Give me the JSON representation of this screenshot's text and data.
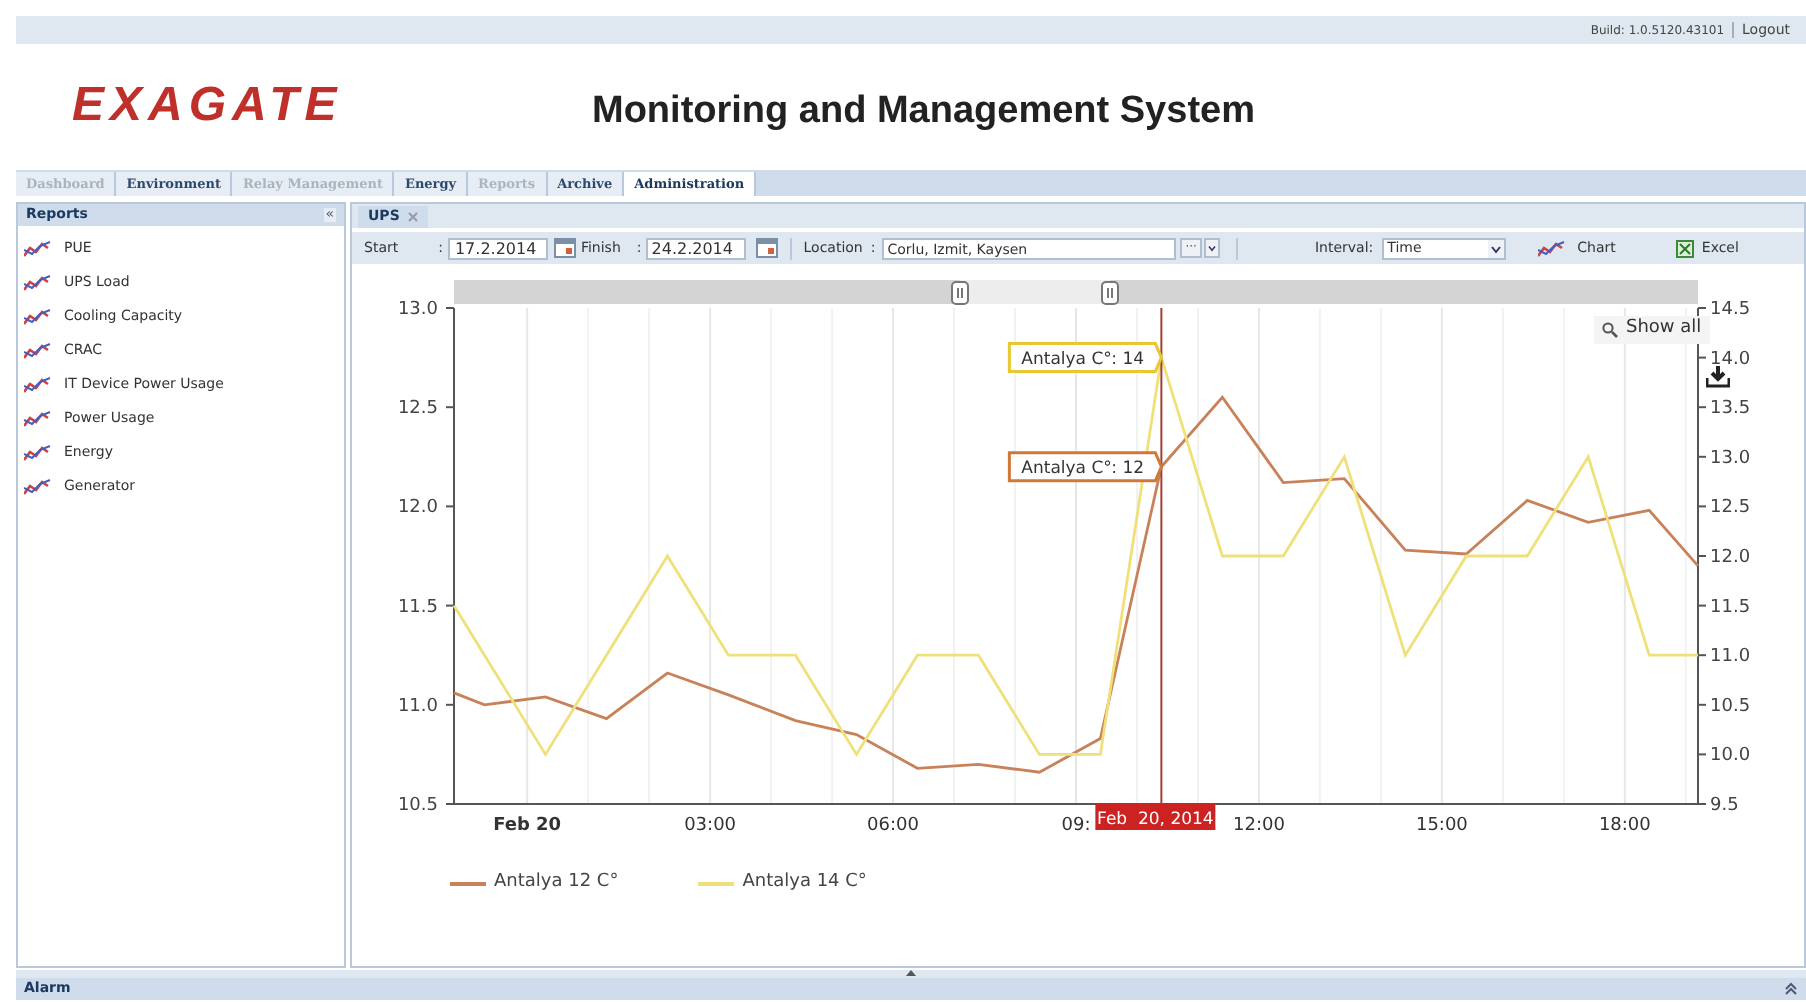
{
  "top_bar": {
    "build": "Build: 1.0.5120.43101",
    "logout": "Logout"
  },
  "header": {
    "logo": "EXAGATE",
    "title": "Monitoring and Management System"
  },
  "nav_tabs": [
    {
      "label": "Dashboard",
      "selected": false,
      "disabled": true
    },
    {
      "label": "Environment",
      "selected": false,
      "disabled": false
    },
    {
      "label": "Relay Management",
      "selected": false,
      "disabled": true
    },
    {
      "label": "Energy",
      "selected": false,
      "disabled": false
    },
    {
      "label": "Reports",
      "selected": false,
      "disabled": true
    },
    {
      "label": "Archive",
      "selected": false,
      "disabled": false
    },
    {
      "label": "Administration",
      "selected": true,
      "disabled": false
    }
  ],
  "sidebar": {
    "title": "Reports",
    "collapse": "«",
    "items": [
      {
        "label": "PUE"
      },
      {
        "label": "UPS Load"
      },
      {
        "label": "Cooling Capacity"
      },
      {
        "label": "CRAC"
      },
      {
        "label": "IT Device Power Usage"
      },
      {
        "label": "Power Usage"
      },
      {
        "label": "Energy"
      },
      {
        "label": "Generator"
      }
    ]
  },
  "content_tabs": [
    {
      "label": "UPS",
      "selected": true
    }
  ],
  "toolbar": {
    "start_label": "Start",
    "start_sep": ":",
    "start": "17.2.2014",
    "finish_label": "Finish",
    "finish_sep": ":",
    "finish": "24.2.2014",
    "location_label": "Location",
    "location_sep": ":",
    "location": "Corlu, Izmit, Kaysen",
    "ellipsis": "···",
    "interval_label": "Interval:",
    "interval": "Time",
    "chart": "Chart",
    "excel": "Excel"
  },
  "chart": {
    "show_all": "Show all",
    "chart_data": {
      "type": "line",
      "x": [
        -1.2,
        -0.7,
        0.3,
        1.3,
        2.3,
        3.3,
        4.4,
        5.4,
        6.4,
        7.4,
        8.4,
        9.4,
        10.4,
        11.4,
        12.4,
        13.4,
        14.4,
        15.4,
        16.4,
        17.4,
        18.4,
        19.2
      ],
      "series": [
        {
          "name": "Antalya 12 C°",
          "color": "#c8825a",
          "values": [
            11.06,
            11.0,
            11.04,
            10.93,
            11.16,
            11.05,
            10.92,
            10.85,
            10.68,
            10.7,
            10.66,
            10.83,
            12.2,
            12.55,
            12.12,
            12.14,
            11.78,
            11.76,
            12.03,
            11.92,
            11.98,
            11.7
          ]
        },
        {
          "name": "Antalya 14 C°",
          "color": "#f0e07a",
          "axis": "y2",
          "values": [
            11.5,
            11.0,
            10.0,
            11.0,
            12.0,
            11.0,
            11.0,
            10.0,
            11.0,
            11.0,
            10.0,
            10.0,
            14.0,
            12.0,
            12.0,
            13.0,
            11.0,
            12.0,
            12.0,
            13.0,
            11.0,
            11.0
          ]
        }
      ],
      "xlim": [
        -1.2,
        19.2
      ],
      "ylim": [
        10.5,
        13.0
      ],
      "y2lim": [
        9.5,
        14.5
      ],
      "xticks": [
        {
          "value": 0,
          "label": "Feb 20"
        },
        {
          "value": 3,
          "label": "03:00"
        },
        {
          "value": 6,
          "label": "06:00"
        },
        {
          "value": 9,
          "label": "09:"
        },
        {
          "value": 12,
          "label": "12:00"
        },
        {
          "value": 15,
          "label": "15:00"
        },
        {
          "value": 18,
          "label": "18:00"
        }
      ],
      "yticks": [
        {
          "value": 10.5,
          "label": "10.5"
        },
        {
          "value": 11,
          "label": "11.0"
        },
        {
          "value": 11.5,
          "label": "11.5"
        },
        {
          "value": 12,
          "label": "12.0"
        },
        {
          "value": 12.5,
          "label": "12.5"
        },
        {
          "value": 13,
          "label": "13.0"
        }
      ],
      "y2ticks": [
        {
          "value": 9.5,
          "label": "9.5"
        },
        {
          "value": 10,
          "label": "10.0"
        },
        {
          "value": 10.5,
          "label": "10.5"
        },
        {
          "value": 11,
          "label": "11.0"
        },
        {
          "value": 11.5,
          "label": "11.5"
        },
        {
          "value": 12,
          "label": "12.0"
        },
        {
          "value": 12.5,
          "label": "12.5"
        },
        {
          "value": 13,
          "label": "13.0"
        },
        {
          "value": 13.5,
          "label": "13.5"
        },
        {
          "value": 14,
          "label": "14.0"
        },
        {
          "value": 14.5,
          "label": "14.5"
        }
      ],
      "grid": true,
      "legend": "bottom",
      "ref_lines": [
        {
          "axis": "x",
          "value": 10.4,
          "label": "Feb  20, 2014",
          "color": "#a04030"
        }
      ]
    },
    "tooltips": [
      {
        "kind": "secondary",
        "label": "Antalya C°",
        "value": ": 14"
      },
      {
        "kind": "primary",
        "label": "Antalya C°",
        "value": ": 12"
      }
    ]
  },
  "bottom_panel": {
    "title": "Alarm"
  }
}
